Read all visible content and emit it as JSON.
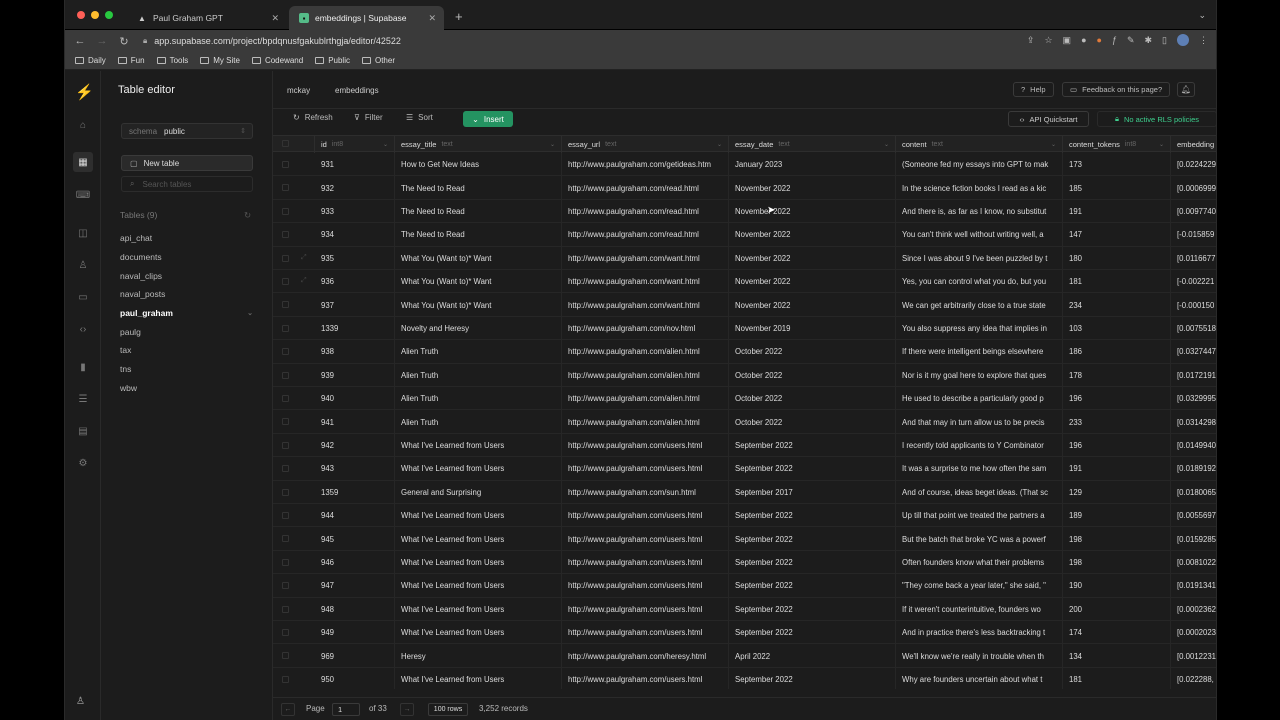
{
  "browser": {
    "tabs": [
      {
        "title": "Paul Graham GPT",
        "icon": "triangle-icon"
      },
      {
        "title": "embeddings | Supabase",
        "icon": "supabase-icon"
      }
    ],
    "url": "app.supabase.com/project/bpdqnusfgakublrthgja/editor/42522",
    "bookmarks": [
      "Daily",
      "Fun",
      "Tools",
      "My Site",
      "Codewand",
      "Public",
      "Other"
    ]
  },
  "sidebar": {
    "title": "Table editor",
    "schema_label": "schema",
    "schema_value": "public",
    "new_table": "New table",
    "search_placeholder": "Search tables",
    "tables_header": "Tables (9)",
    "tables": [
      "api_chat",
      "documents",
      "naval_clips",
      "naval_posts",
      "paul_graham",
      "paulg",
      "tax",
      "tns",
      "wbw"
    ],
    "selected_table": "paul_graham"
  },
  "header": {
    "crumb_project": "mckay",
    "crumb_table": "embeddings",
    "help": "Help",
    "feedback": "Feedback on this page?"
  },
  "actions": {
    "refresh": "Refresh",
    "filter": "Filter",
    "sort": "Sort",
    "insert": "Insert",
    "api_quickstart": "API Quickstart",
    "rls": "No active RLS policies"
  },
  "columns": [
    {
      "name": "id",
      "type": "int8"
    },
    {
      "name": "essay_title",
      "type": "text"
    },
    {
      "name": "essay_url",
      "type": "text"
    },
    {
      "name": "essay_date",
      "type": "text"
    },
    {
      "name": "content",
      "type": "text"
    },
    {
      "name": "content_tokens",
      "type": "int8"
    },
    {
      "name": "embedding",
      "type": ""
    }
  ],
  "rows": [
    [
      "931",
      "How to Get New Ideas",
      "http://www.paulgraham.com/getideas.htm",
      "January 2023",
      "(Someone fed my essays into GPT to mak",
      "173",
      "[0.0224229"
    ],
    [
      "932",
      "The Need to Read",
      "http://www.paulgraham.com/read.html",
      "November 2022",
      "In the science fiction books I read as a kic",
      "185",
      "[0.0006999"
    ],
    [
      "933",
      "The Need to Read",
      "http://www.paulgraham.com/read.html",
      "November 2022",
      "And there is, as far as I know, no substitut",
      "191",
      "[0.0097740"
    ],
    [
      "934",
      "The Need to Read",
      "http://www.paulgraham.com/read.html",
      "November 2022",
      "You can't think well without writing well, a",
      "147",
      "[-0.015859"
    ],
    [
      "935",
      "What You (Want to)* Want",
      "http://www.paulgraham.com/want.html",
      "November 2022",
      "Since I was about 9 I've been puzzled by t",
      "180",
      "[0.0116677"
    ],
    [
      "936",
      "What You (Want to)* Want",
      "http://www.paulgraham.com/want.html",
      "November 2022",
      "Yes, you can control what you do, but you",
      "181",
      "[-0.002221"
    ],
    [
      "937",
      "What You (Want to)* Want",
      "http://www.paulgraham.com/want.html",
      "November 2022",
      "We can get arbitrarily close to a true state",
      "234",
      "[-0.000150"
    ],
    [
      "1339",
      "Novelty and Heresy",
      "http://www.paulgraham.com/nov.html",
      "November 2019",
      "You also suppress any idea that implies in",
      "103",
      "[0.0075518"
    ],
    [
      "938",
      "Alien Truth",
      "http://www.paulgraham.com/alien.html",
      "October 2022",
      "If there were intelligent beings elsewhere",
      "186",
      "[0.0327447"
    ],
    [
      "939",
      "Alien Truth",
      "http://www.paulgraham.com/alien.html",
      "October 2022",
      "Nor is it my goal here to explore that ques",
      "178",
      "[0.0172191"
    ],
    [
      "940",
      "Alien Truth",
      "http://www.paulgraham.com/alien.html",
      "October 2022",
      "He used to describe a particularly good p",
      "196",
      "[0.0329995"
    ],
    [
      "941",
      "Alien Truth",
      "http://www.paulgraham.com/alien.html",
      "October 2022",
      "And that may in turn allow us to be precis",
      "233",
      "[0.0314298"
    ],
    [
      "942",
      "What I've Learned from Users",
      "http://www.paulgraham.com/users.html",
      "September 2022",
      "I recently told applicants to Y Combinator",
      "196",
      "[0.0149940"
    ],
    [
      "943",
      "What I've Learned from Users",
      "http://www.paulgraham.com/users.html",
      "September 2022",
      "It was a surprise to me how often the sam",
      "191",
      "[0.0189192"
    ],
    [
      "1359",
      "General and Surprising",
      "http://www.paulgraham.com/sun.html",
      "September 2017",
      "And of course, ideas beget ideas. (That sc",
      "129",
      "[0.0180065"
    ],
    [
      "944",
      "What I've Learned from Users",
      "http://www.paulgraham.com/users.html",
      "September 2022",
      "Up till that point we treated the partners a",
      "189",
      "[0.0055697"
    ],
    [
      "945",
      "What I've Learned from Users",
      "http://www.paulgraham.com/users.html",
      "September 2022",
      "But the batch that broke YC was a powerf",
      "198",
      "[0.0159285"
    ],
    [
      "946",
      "What I've Learned from Users",
      "http://www.paulgraham.com/users.html",
      "September 2022",
      "Often founders know what their problems",
      "198",
      "[0.0081022"
    ],
    [
      "947",
      "What I've Learned from Users",
      "http://www.paulgraham.com/users.html",
      "September 2022",
      "\"They come back a year later,\" she said, \"",
      "190",
      "[0.0191341"
    ],
    [
      "948",
      "What I've Learned from Users",
      "http://www.paulgraham.com/users.html",
      "September 2022",
      "If it weren't counterintuitive, founders wo",
      "200",
      "[0.0002362"
    ],
    [
      "949",
      "What I've Learned from Users",
      "http://www.paulgraham.com/users.html",
      "September 2022",
      "And in practice there's less backtracking t",
      "174",
      "[0.0002023"
    ],
    [
      "969",
      "Heresy",
      "http://www.paulgraham.com/heresy.html",
      "April 2022",
      "We'll know we're really in trouble when th",
      "134",
      "[0.0012231"
    ],
    [
      "950",
      "What I've Learned from Users",
      "http://www.paulgraham.com/users.html",
      "September 2022",
      "Why are founders uncertain about what t",
      "181",
      "[0.022288,"
    ]
  ],
  "footer": {
    "page_label": "Page",
    "page_value": "1",
    "of_pages": "of 33",
    "rows_per_page": "100 rows",
    "records": "3,252 records"
  }
}
